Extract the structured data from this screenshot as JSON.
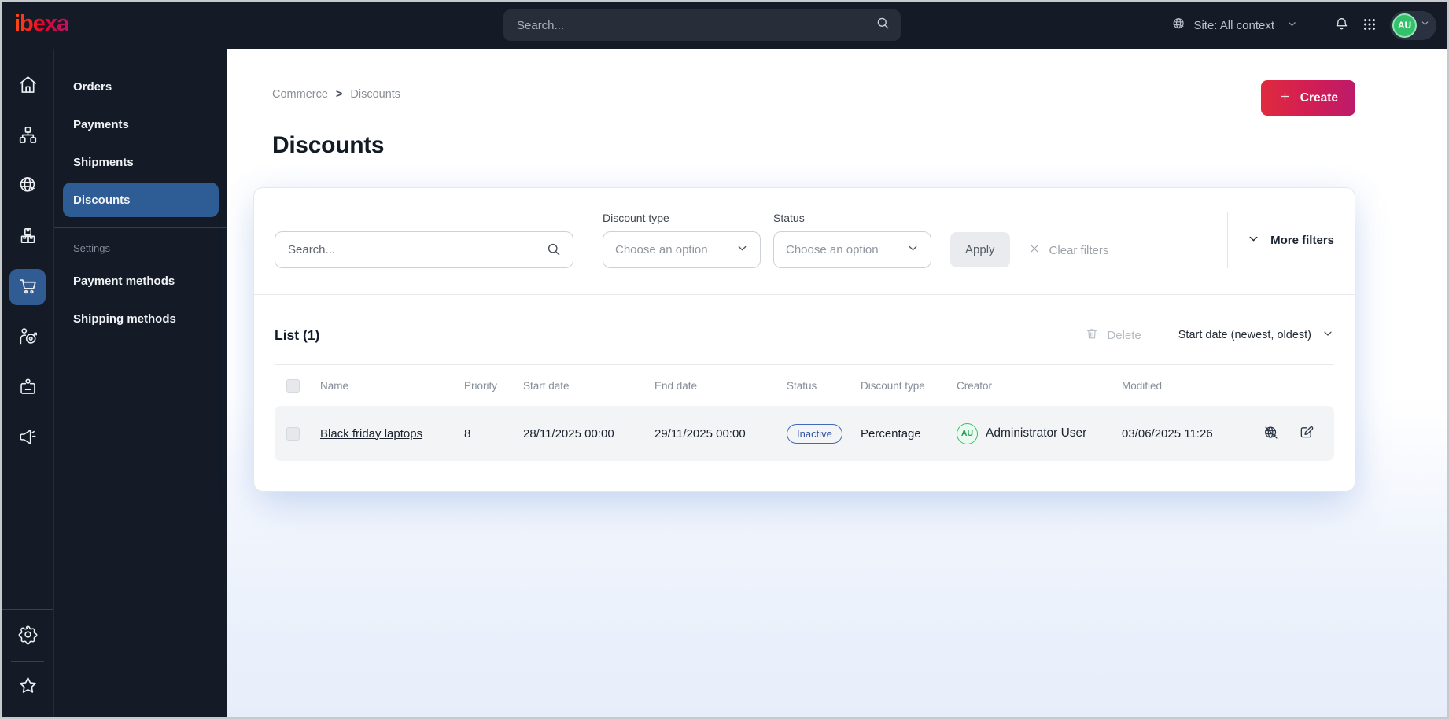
{
  "topbar": {
    "logo_text": "ibexa",
    "search_placeholder": "Search...",
    "site_context_label": "Site: All context",
    "avatar_initials": "AU"
  },
  "icons": {
    "rail": [
      "home",
      "content-structure",
      "site",
      "products",
      "commerce-cart",
      "personalization",
      "customers",
      "marketing"
    ],
    "rail_bottom": [
      "settings",
      "favorites"
    ],
    "topbar": [
      "globe",
      "bell",
      "app-grid",
      "chevron-down",
      "search"
    ],
    "row_actions": [
      "preview-disabled",
      "edit"
    ]
  },
  "sidebar": {
    "items": [
      {
        "label": "Orders",
        "active": false
      },
      {
        "label": "Payments",
        "active": false
      },
      {
        "label": "Shipments",
        "active": false
      },
      {
        "label": "Discounts",
        "active": true
      }
    ],
    "section_label": "Settings",
    "settings_items": [
      {
        "label": "Payment methods"
      },
      {
        "label": "Shipping methods"
      }
    ]
  },
  "breadcrumb": {
    "items": [
      "Commerce",
      "Discounts"
    ],
    "separator": ">"
  },
  "page": {
    "title": "Discounts",
    "create_label": "Create"
  },
  "filters": {
    "search_placeholder": "Search...",
    "discount_type_label": "Discount type",
    "discount_type_value": "Choose an option",
    "status_label": "Status",
    "status_value": "Choose an option",
    "apply_label": "Apply",
    "clear_label": "Clear filters",
    "more_filters_label": "More filters"
  },
  "list": {
    "title": "List (1)",
    "delete_label": "Delete",
    "sort_label": "Start date (newest, oldest)",
    "columns": [
      "Name",
      "Priority",
      "Start date",
      "End date",
      "Status",
      "Discount type",
      "Creator",
      "Modified"
    ],
    "rows": [
      {
        "name": "Black friday laptops",
        "priority": "8",
        "start_date": "28/11/2025 00:00",
        "end_date": "29/11/2025 00:00",
        "status": "Inactive",
        "discount_type": "Percentage",
        "creator_initials": "AU",
        "creator": "Administrator User",
        "modified": "03/06/2025 11:26"
      }
    ]
  },
  "colors": {
    "topbar_bg": "#141b27",
    "active_blue": "#2e5c95",
    "brand_gradient": [
      "#ff4713",
      "#e8002f",
      "#b4176b"
    ],
    "badge_blue": "#4169b8",
    "avatar_green": "#35c06b"
  }
}
